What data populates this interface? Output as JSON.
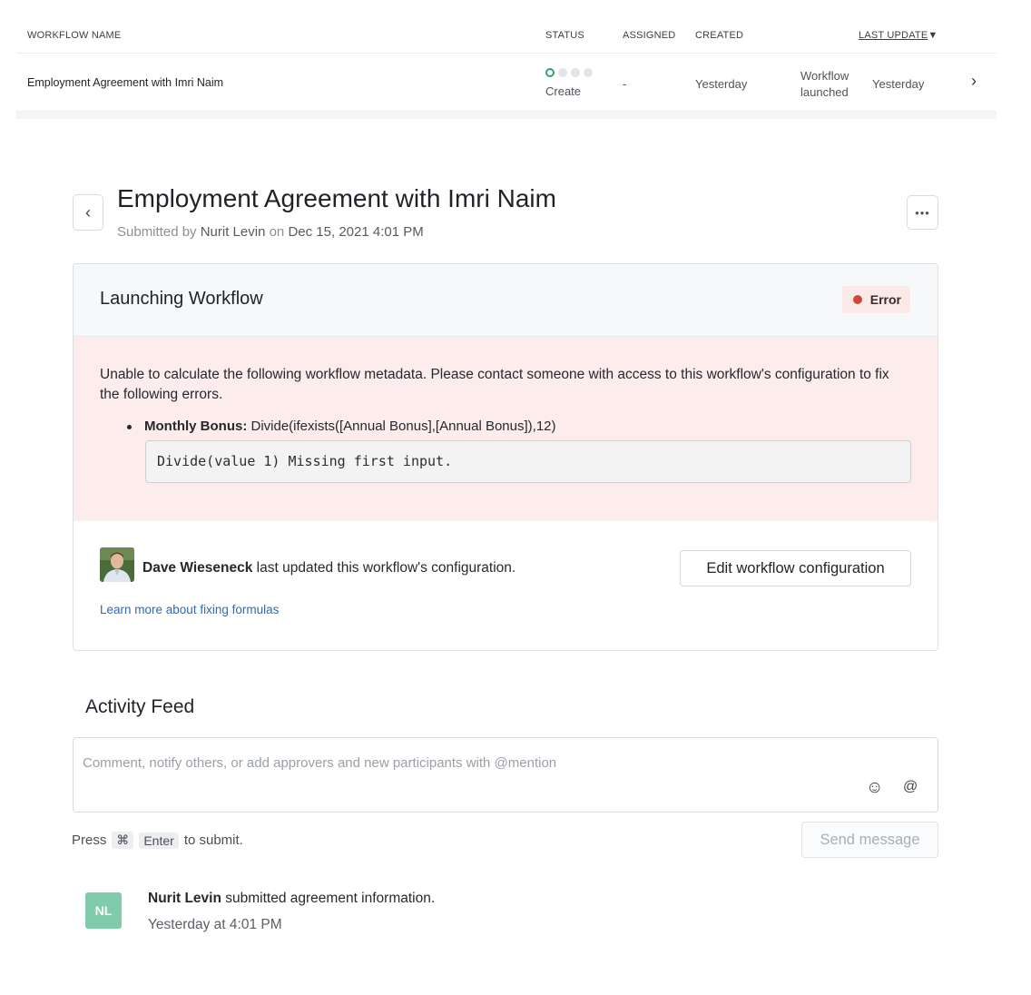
{
  "table": {
    "headers": {
      "name": "WORKFLOW NAME",
      "status": "STATUS",
      "assigned": "ASSIGNED",
      "created": "CREATED",
      "last_update": "LAST UPDATE"
    },
    "row": {
      "name": "Employment Agreement with Imri Naim",
      "status_label": "Create",
      "status_step": 1,
      "status_steps_total": 4,
      "assigned": "-",
      "created": "Yesterday",
      "last_update_event_line1": "Workflow",
      "last_update_event_line2": "launched",
      "last_update_date": "Yesterday"
    }
  },
  "header": {
    "title": "Employment Agreement with Imri Naim",
    "submitted_prefix": "Submitted by",
    "submitted_by": "Nurit Levin",
    "submitted_on_word": "on",
    "submitted_date": "Dec 15, 2021 4:01 PM"
  },
  "card": {
    "title": "Launching Workflow",
    "status_badge": "Error",
    "error_message": "Unable to calculate the following workflow metadata. Please contact someone with access to this workflow's configuration to fix the following errors.",
    "field_name": "Monthly Bonus:",
    "field_formula": "Divide(ifexists([Annual Bonus],[Annual Bonus]),12)",
    "error_detail": "Divide(value 1) Missing first input.",
    "updater_name": "Dave Wieseneck",
    "updater_text": "last updated this workflow's configuration.",
    "edit_button": "Edit workflow configuration",
    "learn_link": "Learn more about fixing formulas"
  },
  "activity": {
    "title": "Activity Feed",
    "comment_placeholder": "Comment, notify others, or add approvers and new participants with @mention",
    "hint_press": "Press",
    "hint_key1": "⌘",
    "hint_key2": "Enter",
    "hint_suffix": "to submit.",
    "send_button": "Send message",
    "feed": [
      {
        "initials": "NL",
        "author": "Nurit Levin",
        "text": "submitted agreement information.",
        "time": "Yesterday at 4:01 PM"
      }
    ]
  },
  "colors": {
    "error_red": "#d2473a",
    "error_bg": "#fcecec",
    "status_green": "#34a36a",
    "avatar_teal": "#7fcbaa",
    "link_blue": "#2d6bb5"
  }
}
